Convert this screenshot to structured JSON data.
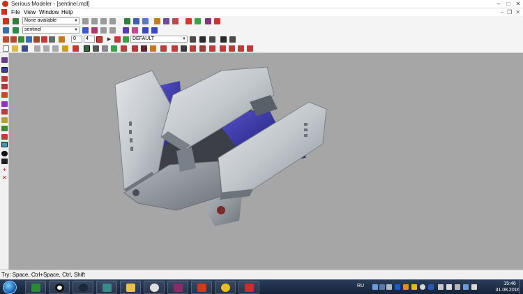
{
  "window": {
    "title": "Serious Modeler - [sentinel.mdl]"
  },
  "menu": {
    "items": [
      "File",
      "View",
      "Window",
      "Help"
    ]
  },
  "toolbar": {
    "animation_combo": "None available",
    "model_combo": "sentinel",
    "frame_value": "0",
    "frame_step": "4",
    "skin_combo": "DEFAULT"
  },
  "status": {
    "text": "Try: Space, Ctrl+Space, Ctrl, Shift"
  },
  "taskbar": {
    "apps": [
      "media-player-icon",
      "opera-icon",
      "steam-icon",
      "modeler-icon",
      "explorer-icon",
      "paint-icon",
      "archiver-icon",
      "game-icon",
      "serious-sam-icon",
      "camera-icon"
    ],
    "language": "RU",
    "time": "15:46",
    "date": "31.08.2016"
  },
  "colors": {
    "viewport_bg": "#a6a6a6",
    "armor": "#c9cdd2",
    "armor_dark": "#8a9098",
    "accent_blue": "#3a36a8"
  }
}
